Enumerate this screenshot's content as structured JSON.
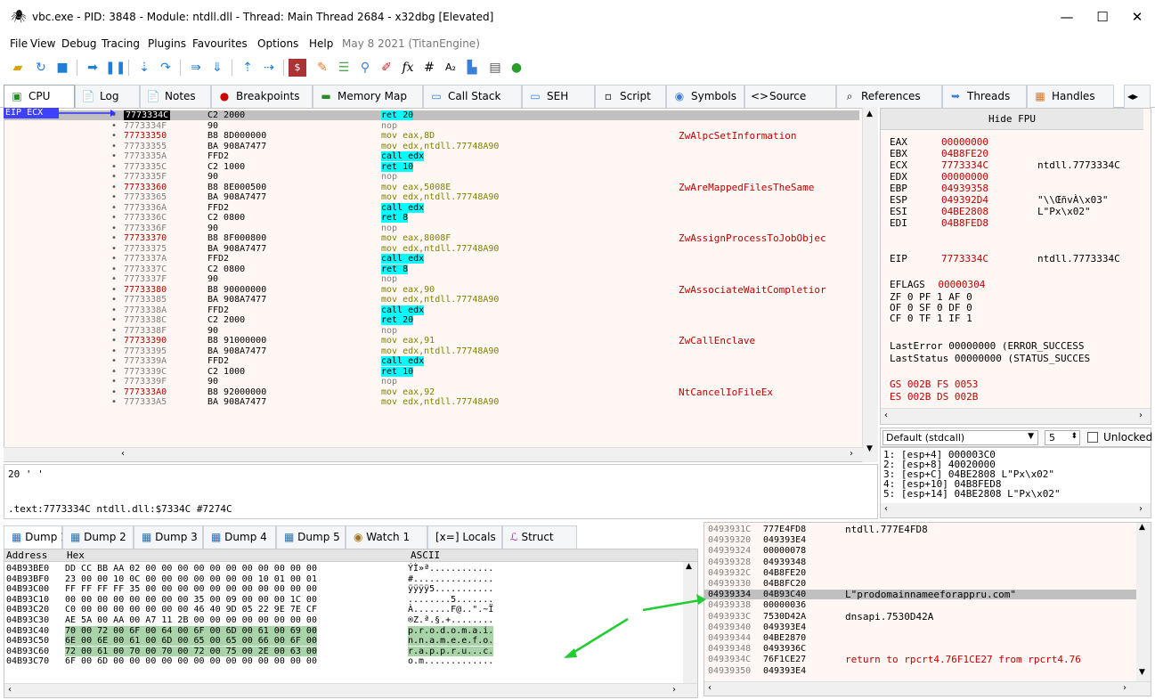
{
  "window": {
    "title": "vbc.exe - PID: 3848 - Module: ntdll.dll - Thread: Main Thread 2684 - x32dbg [Elevated]",
    "controls": [
      "—",
      "☐",
      "✕"
    ]
  },
  "menu": {
    "items": [
      "File",
      "View",
      "Debug",
      "Tracing",
      "Plugins",
      "Favourites",
      "Options",
      "Help"
    ],
    "date": "May 8 2021 (TitanEngine)"
  },
  "tabs": [
    "CPU",
    "Log",
    "Notes",
    "Breakpoints",
    "Memory Map",
    "Call Stack",
    "SEH",
    "Script",
    "Symbols",
    "Source",
    "References",
    "Threads",
    "Handles"
  ],
  "disasm": {
    "eip_label": "EIP ECX",
    "rows": [
      {
        "addr": "7773334C",
        "bytes": "C2 2000",
        "ins": "ret 20",
        "sel": true
      },
      {
        "addr": "7773334F",
        "bytes": "90",
        "ins": "nop"
      },
      {
        "addr": "77733350",
        "bytes": "B8 8D000000",
        "ins": "mov eax,8D",
        "sys": true,
        "comment": "ZwAlpcSetInformation"
      },
      {
        "addr": "77733355",
        "bytes": "BA 908A7477",
        "ins": "mov edx,ntdll.77748A90"
      },
      {
        "addr": "7773335A",
        "bytes": "FFD2",
        "ins": "call edx"
      },
      {
        "addr": "7773335C",
        "bytes": "C2 1000",
        "ins": "ret 10"
      },
      {
        "addr": "7773335F",
        "bytes": "90",
        "ins": "nop"
      },
      {
        "addr": "77733360",
        "bytes": "B8 8E000500",
        "ins": "mov eax,5008E",
        "sys": true,
        "comment": "ZwAreMappedFilesTheSame"
      },
      {
        "addr": "77733365",
        "bytes": "BA 908A7477",
        "ins": "mov edx,ntdll.77748A90"
      },
      {
        "addr": "7773336A",
        "bytes": "FFD2",
        "ins": "call edx"
      },
      {
        "addr": "7773336C",
        "bytes": "C2 0800",
        "ins": "ret 8"
      },
      {
        "addr": "7773336F",
        "bytes": "90",
        "ins": "nop"
      },
      {
        "addr": "77733370",
        "bytes": "B8 8F000800",
        "ins": "mov eax,8008F",
        "sys": true,
        "comment": "ZwAssignProcessToJobObjec"
      },
      {
        "addr": "77733375",
        "bytes": "BA 908A7477",
        "ins": "mov edx,ntdll.77748A90"
      },
      {
        "addr": "7773337A",
        "bytes": "FFD2",
        "ins": "call edx"
      },
      {
        "addr": "7773337C",
        "bytes": "C2 0800",
        "ins": "ret 8"
      },
      {
        "addr": "7773337F",
        "bytes": "90",
        "ins": "nop"
      },
      {
        "addr": "77733380",
        "bytes": "B8 90000000",
        "ins": "mov eax,90",
        "sys": true,
        "comment": "ZwAssociateWaitCompletior"
      },
      {
        "addr": "77733385",
        "bytes": "BA 908A7477",
        "ins": "mov edx,ntdll.77748A90"
      },
      {
        "addr": "7773338A",
        "bytes": "FFD2",
        "ins": "call edx"
      },
      {
        "addr": "7773338C",
        "bytes": "C2 2000",
        "ins": "ret 20"
      },
      {
        "addr": "7773338F",
        "bytes": "90",
        "ins": "nop"
      },
      {
        "addr": "77733390",
        "bytes": "B8 91000000",
        "ins": "mov eax,91",
        "sys": true,
        "comment": "ZwCallEnclave"
      },
      {
        "addr": "77733395",
        "bytes": "BA 908A7477",
        "ins": "mov edx,ntdll.77748A90"
      },
      {
        "addr": "7773339A",
        "bytes": "FFD2",
        "ins": "call edx"
      },
      {
        "addr": "7773339C",
        "bytes": "C2 1000",
        "ins": "ret 10"
      },
      {
        "addr": "7773339F",
        "bytes": "90",
        "ins": "nop"
      },
      {
        "addr": "777333A0",
        "bytes": "B8 92000000",
        "ins": "mov eax,92",
        "sys": true,
        "comment": "NtCancelIoFileEx"
      },
      {
        "addr": "777333A5",
        "bytes": "BA 908A7477",
        "ins": "mov edx,ntdll.77748A90"
      }
    ]
  },
  "info": {
    "line1": "20 ' '",
    "line2": ".text:7773334C ntdll.dll:$7334C #7274C"
  },
  "registers": {
    "hide_fpu": "Hide FPU",
    "gp": [
      {
        "name": "EAX",
        "value": "00000000",
        "comment": ""
      },
      {
        "name": "EBX",
        "value": "04B8FE20",
        "comment": ""
      },
      {
        "name": "ECX",
        "value": "7773334C",
        "comment": "ntdll.7773334C"
      },
      {
        "name": "EDX",
        "value": "00000000",
        "comment": ""
      },
      {
        "name": "EBP",
        "value": "04939358",
        "comment": ""
      },
      {
        "name": "ESP",
        "value": "049392D4",
        "comment": "\"\\\\ŒñvÀ\\x03\""
      },
      {
        "name": "ESI",
        "value": "04BE2808",
        "comment": "L\"Px\\x02\""
      },
      {
        "name": "EDI",
        "value": "04B8FED8",
        "comment": ""
      }
    ],
    "eip": {
      "name": "EIP",
      "value": "7773334C",
      "comment": "ntdll.7773334C"
    },
    "eflags_label": "EFLAGS",
    "eflags_value": "00000304",
    "flags": [
      "ZF 0  PF 1  AF 0",
      "OF 0  SF 0  DF 0",
      "CF 0  TF 1  IF 1"
    ],
    "last_error": "LastError  00000000 (ERROR_SUCCESS",
    "last_status": "LastStatus 00000000 (STATUS_SUCCES",
    "seg1": "GS 002B  FS 0053",
    "seg2": "ES 002B  DS 002B"
  },
  "callconv": {
    "selected": "Default (stdcall)",
    "count": "5",
    "unlocked": "Unlocked"
  },
  "stack_args": [
    "1: [esp+4] 000003C0",
    "2: [esp+8] 40020000",
    "3: [esp+C] 04BE2808 L\"Px\\x02\"",
    "4: [esp+10] 04B8FED8",
    "5: [esp+14] 04BE2808 L\"Px\\x02\""
  ],
  "dump_tabs": [
    "Dump 1",
    "Dump 2",
    "Dump 3",
    "Dump 4",
    "Dump 5",
    "Watch 1",
    "Locals",
    "Struct"
  ],
  "dump": {
    "headers": {
      "address": "Address",
      "hex": "Hex",
      "ascii": "ASCII"
    },
    "rows": [
      {
        "addr": "04B93BE0",
        "hex": "DD CC BB AA 02 00 00 00 00 00 00 00 00 00 00 00",
        "ascii": "ÝÌ»ª............"
      },
      {
        "addr": "04B93BF0",
        "hex": "23 00 00 10 0C 00 00 00 00 00 00 00 10 01 00 01",
        "ascii": "#..............."
      },
      {
        "addr": "04B93C00",
        "hex": "FF FF FF FF 35 00 00 00 00 00 00 00 00 00 00 00",
        "ascii": "ÿÿÿÿ5..........."
      },
      {
        "addr": "04B93C10",
        "hex": "00 00 00 00 00 00 00 00 35 00 09 00 00 00 1C 00",
        "ascii": "........5......."
      },
      {
        "addr": "04B93C20",
        "hex": "C0 00 00 00 00 00 00 00 46 40 9D 05 22 9E 7E CF",
        "ascii": "À.......F@..\".~Ï"
      },
      {
        "addr": "04B93C30",
        "hex": "AE 5A 00 AA 00 A7 11 2B 00 00 00 00 00 00 00 00",
        "ascii": "®Z.ª.§.+........"
      },
      {
        "addr": "04B93C40",
        "hex": "70 00 72 00 6F 00 64 00 6F 00 6D 00 61 00 69 00",
        "ascii": "p.r.o.d.o.m.a.i.",
        "hl": true
      },
      {
        "addr": "04B93C50",
        "hex": "6E 00 6E 00 61 00 6D 00 65 00 65 00 66 00 6F 00",
        "ascii": "n.n.a.m.e.e.f.o.",
        "hl": true
      },
      {
        "addr": "04B93C60",
        "hex": "72 00 61 00 70 00 70 00 72 00 75 00 2E 00 63 00",
        "ascii": "r.a.p.p.r.u...c.",
        "hl": true
      },
      {
        "addr": "04B93C70",
        "hex": "6F 00 6D 00 00 00 00 00 00 00 00 00 00 00 00 00",
        "ascii": "o.m.............",
        "hl": "partial"
      }
    ]
  },
  "stack": {
    "rows": [
      {
        "addr": "0493931C",
        "val": "777E4FD8",
        "comment": "ntdll.777E4FD8"
      },
      {
        "addr": "04939320",
        "val": "049393E4",
        "comment": ""
      },
      {
        "addr": "04939324",
        "val": "00000078",
        "comment": ""
      },
      {
        "addr": "04939328",
        "val": "04939348",
        "comment": ""
      },
      {
        "addr": "0493932C",
        "val": "04B8FE20",
        "comment": ""
      },
      {
        "addr": "04939330",
        "val": "04B8FC20",
        "comment": ""
      },
      {
        "addr": "04939334",
        "val": "04B93C40",
        "comment": "L\"prodomainnameeforappru.com\"",
        "sel": true
      },
      {
        "addr": "04939338",
        "val": "00000036",
        "comment": ""
      },
      {
        "addr": "0493933C",
        "val": "7530D42A",
        "comment": "dnsapi.7530D42A"
      },
      {
        "addr": "04939340",
        "val": "049393E4",
        "comment": ""
      },
      {
        "addr": "04939344",
        "val": "04BE2870",
        "comment": ""
      },
      {
        "addr": "04939348",
        "val": "0493936C",
        "comment": ""
      },
      {
        "addr": "0493934C",
        "val": "76F1CE27",
        "comment": "return to rpcrt4.76F1CE27 from rpcrt4.76",
        "red": true
      },
      {
        "addr": "04939350",
        "val": "049393E4",
        "comment": ""
      }
    ]
  },
  "colors": {
    "accent": "#4040ff",
    "highlight_green": "#a9d3a9",
    "arrow_green": "#22cc33",
    "syscall_red": "#c00000"
  }
}
